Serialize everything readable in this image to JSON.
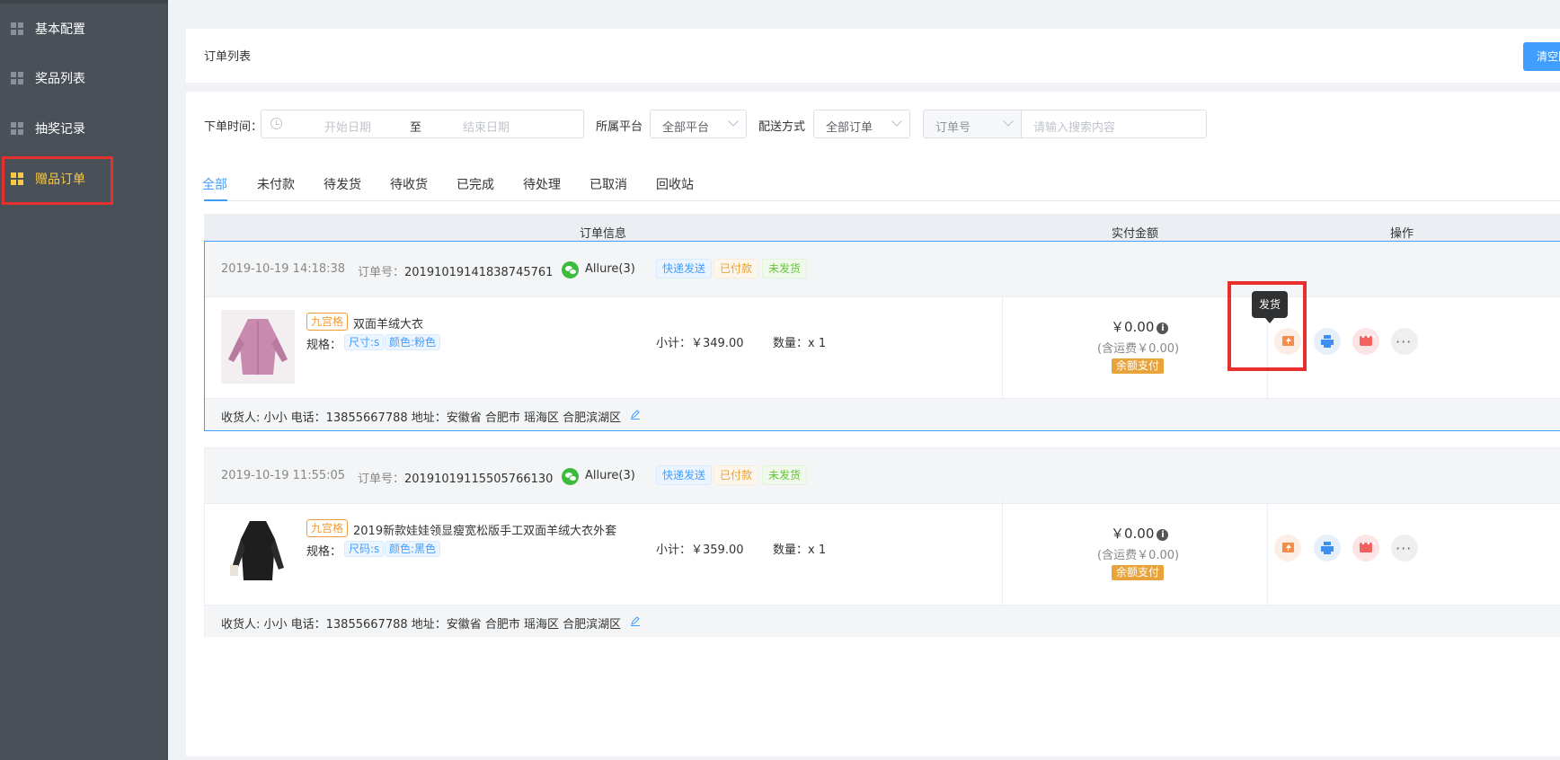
{
  "sidebar": {
    "items": [
      {
        "label": "基本配置"
      },
      {
        "label": "奖品列表"
      },
      {
        "label": "抽奖记录"
      },
      {
        "label": "赠品订单"
      }
    ]
  },
  "header": {
    "title": "订单列表",
    "clear_btn": "清空回收站"
  },
  "filters": {
    "time_label": "下单时间：",
    "start_placeholder": "开始日期",
    "range_sep": "至",
    "end_placeholder": "结束日期",
    "platform_label": "所属平台",
    "platform_value": "全部平台",
    "delivery_label": "配送方式",
    "delivery_value": "全部订单",
    "search_type": "订单号",
    "search_placeholder": "请输入搜索内容"
  },
  "tabs": [
    "全部",
    "未付款",
    "待发货",
    "待收货",
    "已完成",
    "待处理",
    "已取消",
    "回收站"
  ],
  "table_header": {
    "info": "订单信息",
    "amount": "实付金额",
    "ops": "操作"
  },
  "tooltip": "发货",
  "orders": [
    {
      "date": "2019-10-19 14:18:38",
      "order_no_label": "订单号：",
      "order_no": "20191019141838745761",
      "user": "Allure(3)",
      "tags": [
        "快递发送",
        "已付款",
        "未发货"
      ],
      "badge": "九宫格",
      "name": "双面羊绒大衣",
      "spec_label": "规格：",
      "specs": [
        "尺寸:s",
        "颜色:粉色"
      ],
      "subtotal": "小计：￥349.00",
      "qty": "数量：x 1",
      "pay_amount": "￥0.00",
      "freight": "(含运费￥0.00)",
      "pay_method": "余额支付",
      "address": "收货人: 小小  电话：13855667788  地址：安徽省 合肥市 瑶海区 合肥滨湖区",
      "image_color": "#c98ab0"
    },
    {
      "date": "2019-10-19 11:55:05",
      "order_no_label": "订单号：",
      "order_no": "20191019115505766130",
      "user": "Allure(3)",
      "tags": [
        "快递发送",
        "已付款",
        "未发货"
      ],
      "badge": "九宫格",
      "name": "2019新款娃娃领显瘦宽松版手工双面羊绒大衣外套",
      "spec_label": "规格：",
      "specs": [
        "尺码:s",
        "颜色:黑色"
      ],
      "subtotal": "小计：￥359.00",
      "qty": "数量：x 1",
      "pay_amount": "￥0.00",
      "freight": "(含运费￥0.00)",
      "pay_method": "余额支付",
      "address": "收货人: 小小  电话：13855667788  地址：安徽省 合肥市 瑶海区 合肥滨湖区",
      "image_color": "#1e1e1e"
    }
  ]
}
